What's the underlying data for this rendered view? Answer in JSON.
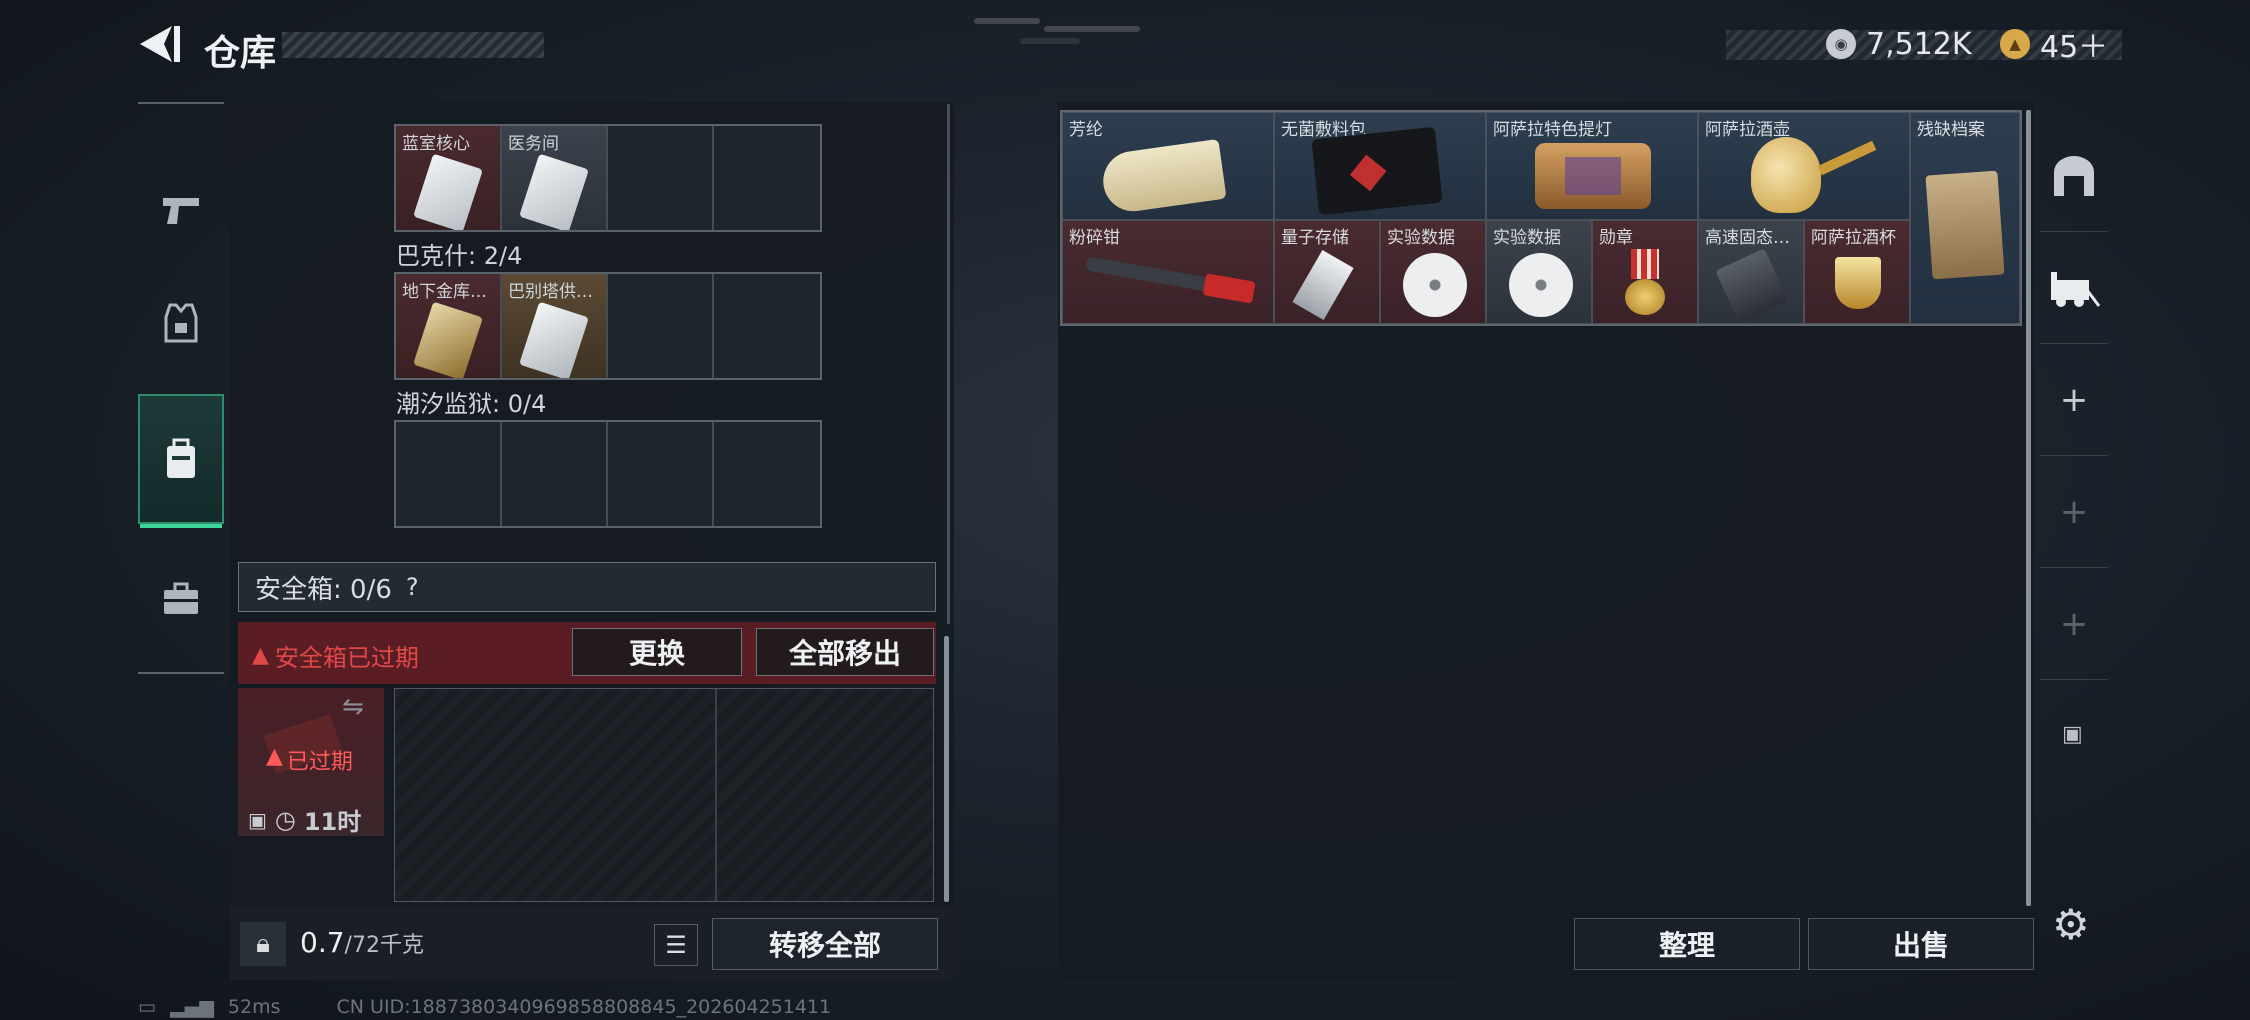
{
  "header": {
    "title": "仓库"
  },
  "currency": {
    "silver": "7,512K",
    "gold": "45＋"
  },
  "sidebar": {
    "items": [
      {
        "icon": "pistol-icon"
      },
      {
        "icon": "armor-vest-icon"
      },
      {
        "icon": "backpack-icon",
        "active": true
      },
      {
        "icon": "briefcase-icon"
      }
    ]
  },
  "left": {
    "sections": [
      {
        "label": "",
        "items": [
          {
            "name": "蓝室核心",
            "bg": "red"
          },
          {
            "name": "医务间",
            "bg": "gray"
          },
          null,
          null
        ]
      },
      {
        "label": "巴克什: 2/4",
        "items": [
          {
            "name": "地下金库…",
            "bg": "red"
          },
          {
            "name": "巴别塔供…",
            "bg": "gold"
          },
          null,
          null
        ]
      },
      {
        "label": "潮汐监狱: 0/4",
        "items": [
          null,
          null,
          null,
          null
        ]
      }
    ],
    "safe_box": {
      "label": "安全箱: 0/6",
      "help": "?"
    },
    "warning": {
      "text": "安全箱已过期",
      "replace_btn": "更换",
      "move_all_btn": "全部移出"
    },
    "expired": {
      "label": "已过期",
      "timer": "11时"
    },
    "weight": {
      "value": "0.7",
      "max": "/72千克"
    },
    "transfer_btn": "转移全部"
  },
  "stash": {
    "items": [
      {
        "name": "芳纶",
        "bg": "blue"
      },
      {
        "name": "无菌敷料包",
        "bg": "blue"
      },
      {
        "name": "阿萨拉特色提灯",
        "bg": "blue"
      },
      {
        "name": "阿萨拉酒壶",
        "bg": "blue"
      },
      {
        "name": "残缺档案",
        "bg": "blue"
      },
      {
        "name": "粉碎钳",
        "bg": "red"
      },
      {
        "name": "量子存储",
        "bg": "red"
      },
      {
        "name": "实验数据",
        "bg": "red"
      },
      {
        "name": "实验数据",
        "bg": "gray"
      },
      {
        "name": "勋章",
        "bg": "red"
      },
      {
        "name": "高速固态…",
        "bg": "gray"
      },
      {
        "name": "阿萨拉酒杯",
        "bg": "red"
      }
    ],
    "sort_btn": "整理",
    "sell_btn": "出售"
  },
  "right_nav": {
    "items": [
      "tunnel-icon",
      "vehicle-icon",
      "+",
      "+",
      "+",
      "lock-icon"
    ]
  },
  "status": {
    "ping": "52ms",
    "uid": "CN UID:1887380340969858808845_202604251411"
  },
  "colors": {
    "accent": "#3fd69a",
    "warning": "#e04848",
    "panel": "#161b22"
  }
}
